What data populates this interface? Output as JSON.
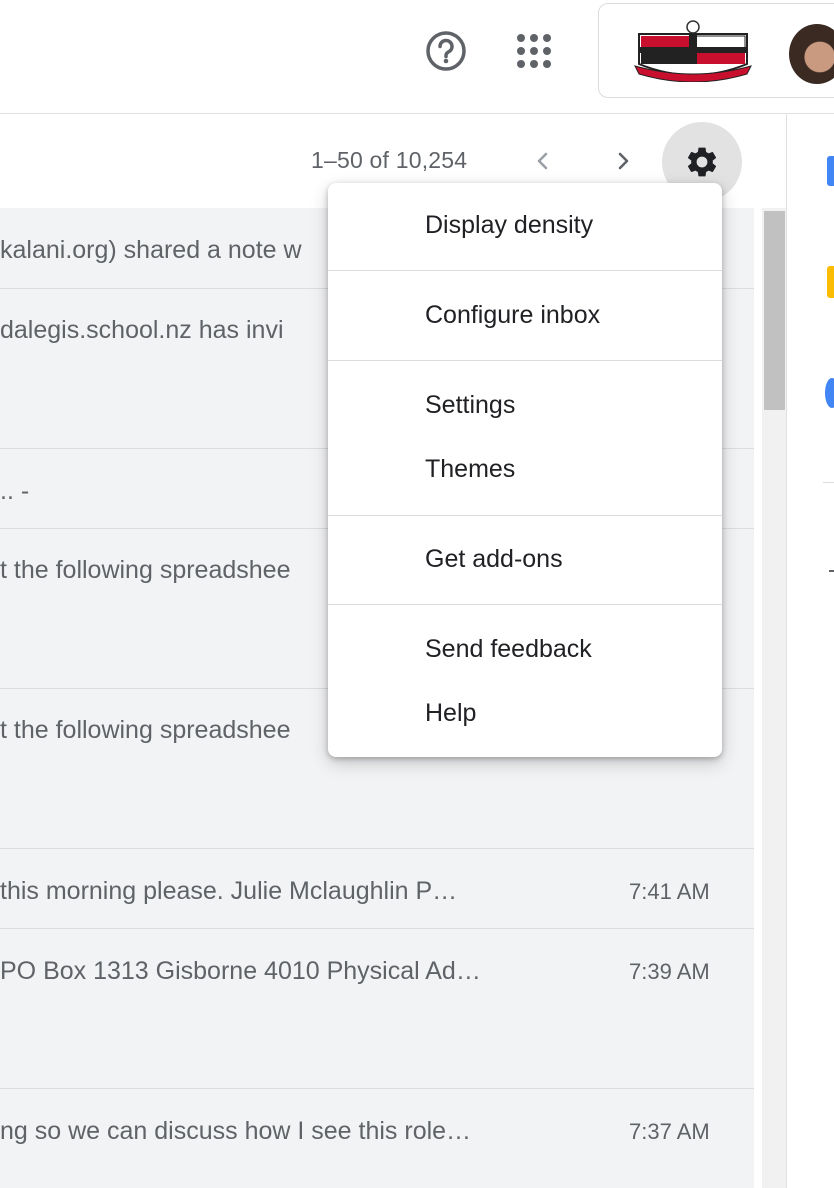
{
  "header": {
    "help_icon": "help-circle-icon",
    "apps_icon": "apps-grid-icon",
    "account_logo": "school-crest-logo",
    "account_avatar": "user-avatar"
  },
  "toolbar": {
    "page_count": "1–50 of 10,254",
    "prev_icon": "chevron-left-icon",
    "next_icon": "chevron-right-icon",
    "settings_icon": "gear-icon"
  },
  "settings_menu": {
    "items": [
      {
        "label": "Display density"
      },
      {
        "label": "Configure inbox"
      },
      {
        "label": "Settings"
      },
      {
        "label": "Themes"
      },
      {
        "label": "Get add-ons"
      },
      {
        "label": "Send feedback"
      },
      {
        "label": "Help"
      }
    ]
  },
  "emails": [
    {
      "snippet": "kalani.org) shared a note w",
      "time": ""
    },
    {
      "snippet": "dalegis.school.nz has invi",
      "time": ""
    },
    {
      "snippet": ".. -",
      "time": ""
    },
    {
      "snippet": "t the following spreadshee",
      "time": ""
    },
    {
      "snippet": "t the following spreadshee",
      "time": ""
    },
    {
      "snippet": " this morning please. Julie Mclaughlin P…",
      "time": "7:41 AM"
    },
    {
      "snippet": "PO Box 1313 Gisborne 4010 Physical Ad…",
      "time": "7:39 AM"
    },
    {
      "snippet": "ng so we can discuss how I see this role…",
      "time": "7:37 AM"
    }
  ],
  "colors": {
    "list_background": "#f2f3f4",
    "text_primary": "#202124",
    "text_secondary": "#5f6368",
    "gear_button_bg": "#e2e2e2"
  }
}
